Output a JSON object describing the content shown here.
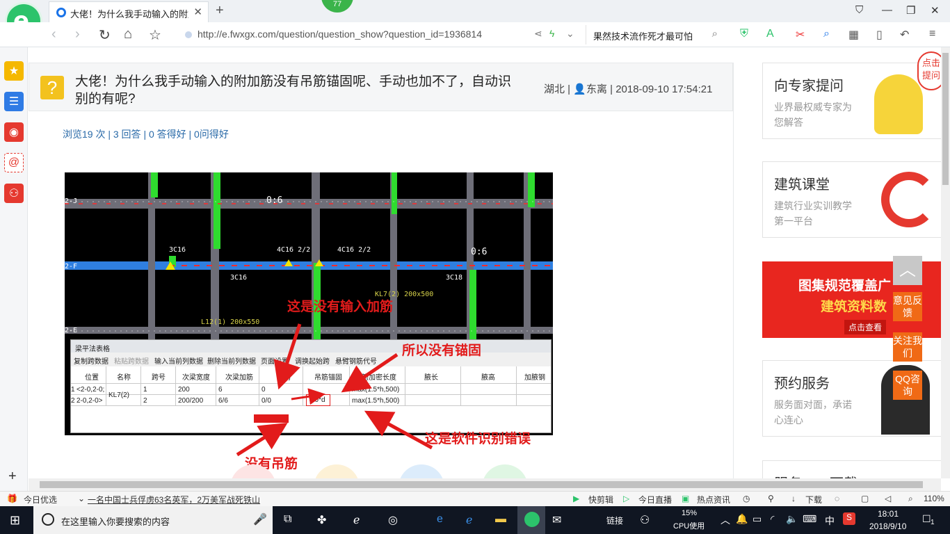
{
  "browser": {
    "tab_title": "大佬！为什么我手动输入的附加筋",
    "badge_count": "77",
    "url": "http://e.fwxgx.com/question/question_show?question_id=1936814",
    "search_text": "果然技术流作死才最可怕"
  },
  "question": {
    "title": "大佬！为什么我手动输入的附加筋没有吊筋锚固呢、手动也加不了，自动识别的有呢?",
    "region": "湖北",
    "user": "东离",
    "datetime": "2018-09-10 17:54:21",
    "stats": "浏览19 次 | 3 回答 | 0 答得好 | 0问得好"
  },
  "screenshot": {
    "table_title": "梁平法表格",
    "toolbar": [
      "复制跨数据",
      "粘贴跨数据",
      "输入当前列数据",
      "删除当前列数据",
      "页面设置",
      "调换起始跨",
      "悬臂钢筋代号"
    ],
    "headers": [
      "位置",
      "名称",
      "跨号",
      "次梁宽度",
      "次梁加筋",
      "吊筋",
      "吊筋锚固",
      "箍筋加密长度",
      "腋长",
      "腋高",
      "加腋钢"
    ],
    "rows": [
      {
        "num": "1",
        "pos": "<2-0,2-0;",
        "name": "KL7(2)",
        "span": "1",
        "width": "200",
        "add": "6",
        "hang": "0",
        "anchor": "",
        "dense": "max(1.5*h,500)"
      },
      {
        "num": "2",
        "pos": "2-0,2-0>",
        "name": "",
        "span": "2",
        "width": "200/200",
        "add": "6/6",
        "hang": "0/0",
        "anchor": "20*d",
        "dense": "max(1.5*h,500)"
      }
    ],
    "cad_labels": [
      "3C16",
      "4C16 2/2",
      "4C16 2/2",
      "3C16",
      "3C18",
      "0:6",
      "0:6",
      "2-J",
      "2-F",
      "2-E",
      "KL7(2) 200x500",
      "L12(1) 200x550"
    ]
  },
  "annotations": {
    "a1": "这是没有输入加筋",
    "a2": "所以没有锚固",
    "a3": "这是软件识别错误",
    "a4": "没有吊筋"
  },
  "sidebar_cards": [
    {
      "title": "向专家提问",
      "sub": "业界最权威专家为您解答"
    },
    {
      "title": "建筑课堂",
      "sub": "建筑行业实训教学第一平台"
    },
    {
      "title": "预约服务",
      "sub": "服务面对面，承诺心连心"
    },
    {
      "title": "服务APP下载",
      "sub": ""
    }
  ],
  "banner": {
    "line1": "图集规范覆盖广",
    "line2": "建筑资料数",
    "link": "点击查看"
  },
  "float_buttons": [
    "意见反馈",
    "关注我们",
    "QQ咨询"
  ],
  "corner_badge": "点击提问",
  "statusbar": {
    "left": "今日优选",
    "news": "一名中国士兵俘虏63名英军，2万美军战死铁山",
    "items": [
      "快剪辑",
      "今日直播",
      "热点资讯",
      "下载",
      "110%"
    ]
  },
  "taskbar": {
    "search_placeholder": "在这里输入你要搜索的内容",
    "link": "链接",
    "cpu_pct": "15%",
    "cpu_label": "CPU使用",
    "ime": "中",
    "time": "18:01",
    "date": "2018/9/10",
    "notif": "1"
  }
}
